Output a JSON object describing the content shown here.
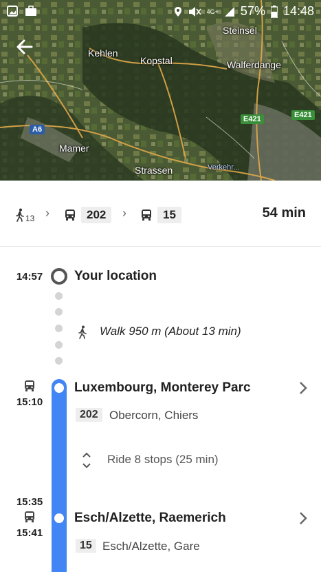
{
  "status_bar": {
    "network": "4G+",
    "battery": "57%",
    "time": "14:48"
  },
  "map": {
    "labels": [
      "Steinsel",
      "Kehlen",
      "Kopstal",
      "Walferdange",
      "E421",
      "E421",
      "A6",
      "Mamer",
      "Strassen",
      "Verkehr..."
    ]
  },
  "summary": {
    "walk_minutes": "13",
    "bus1": "202",
    "bus2": "15",
    "total": "54 min"
  },
  "timeline": {
    "origin_time": "14:57",
    "origin_name": "Your location",
    "walk_text": "Walk 950 m (About 13 min)",
    "stop1_time": "15:10",
    "stop1_name": "Luxembourg, Monterey Parc",
    "stop1_line": "202",
    "stop1_dest": "Obercorn, Chiers",
    "ride_text": "Ride 8 stops (25 min)",
    "arrive_time": "15:35",
    "stop2_time": "15:41",
    "stop2_name": "Esch/Alzette, Raemerich",
    "stop2_line": "15",
    "stop2_dest": "Esch/Alzette, Gare"
  },
  "colors": {
    "accent_blue": "#4285f4",
    "motorway_green": "#3a8f3a",
    "motorway_blue": "#2b5da8"
  }
}
